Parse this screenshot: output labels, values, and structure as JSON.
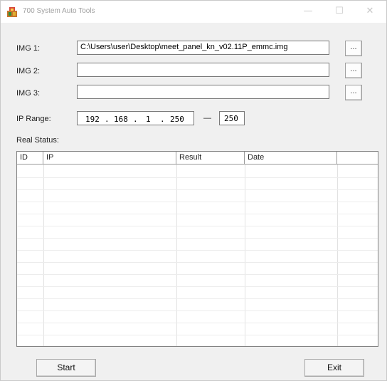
{
  "window": {
    "title": "700 System Auto Tools"
  },
  "titlebar_buttons": {
    "minimize": "—",
    "maximize": "☐",
    "close": "✕"
  },
  "img_fields": [
    {
      "label": "IMG 1:",
      "value": "C:\\Users\\user\\Desktop\\meet_panel_kn_v02.11P_emmc.img",
      "browse_label": "..."
    },
    {
      "label": "IMG 2:",
      "value": "",
      "browse_label": "..."
    },
    {
      "label": "IMG 3:",
      "value": "",
      "browse_label": "..."
    }
  ],
  "ip_range": {
    "label": "IP Range:",
    "octets": [
      "192",
      "168",
      "1",
      "250"
    ],
    "dot": ".",
    "separator": "—",
    "end": "250"
  },
  "status": {
    "label": "Real Status:",
    "columns": [
      "ID",
      "IP",
      "Result",
      "Date",
      ""
    ],
    "rows": []
  },
  "buttons": {
    "start": "Start",
    "exit": "Exit"
  }
}
